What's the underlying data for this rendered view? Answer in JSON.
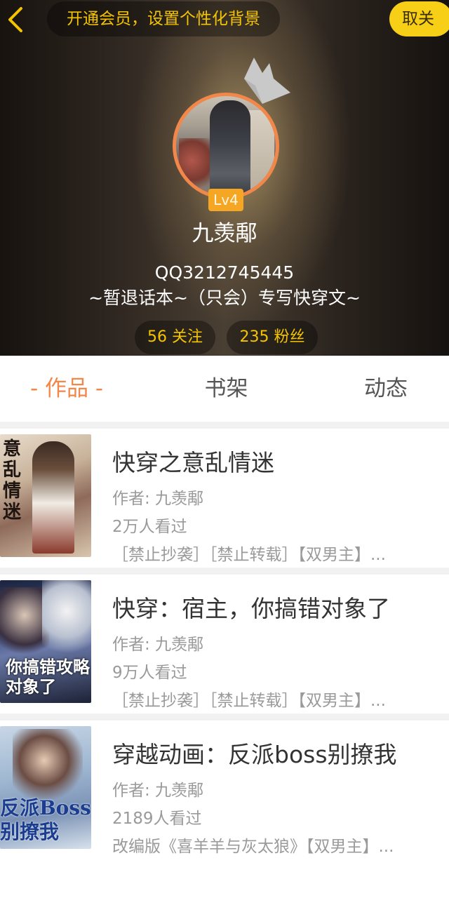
{
  "header": {
    "vip_banner": "开通会员，设置个性化背景",
    "follow_label": "取关"
  },
  "profile": {
    "level": "Lv4",
    "nickname": "九羡鄅",
    "qq": "QQ3212745445",
    "motto": "~暂退话本~（只会）专写快穿文~",
    "following": "56 关注",
    "fans": "235 粉丝"
  },
  "tabs": [
    {
      "label": "- 作品 -",
      "active": true
    },
    {
      "label": "书架",
      "active": false
    },
    {
      "label": "动态",
      "active": false
    }
  ],
  "books": [
    {
      "title": "快穿之意乱情迷",
      "author": "作者: 九羡鄅",
      "views": "2万人看过",
      "tags": "［禁止抄袭］［禁止转载］【双男主】..."
    },
    {
      "title": "快穿：宿主，你搞错对象了",
      "author": "作者: 九羡鄅",
      "views": "9万人看过",
      "tags": "［禁止抄袭］［禁止转载］【双男主】..."
    },
    {
      "title": "穿越动画：反派boss别撩我",
      "author": "作者: 九羡鄅",
      "views": "2189人看过",
      "tags": "改编版《喜羊羊与灰太狼》【双男主】..."
    }
  ],
  "covers": {
    "book1": "意乱情迷",
    "book2": "你搞错攻略对象了",
    "book3": "反派Boss别撩我"
  },
  "colors": {
    "accent": "#f2874a",
    "gold": "#f5c400",
    "follow_button": "#f7cf16"
  },
  "icons": {
    "back": "chevron-left-icon",
    "crown": "crown-icon"
  }
}
